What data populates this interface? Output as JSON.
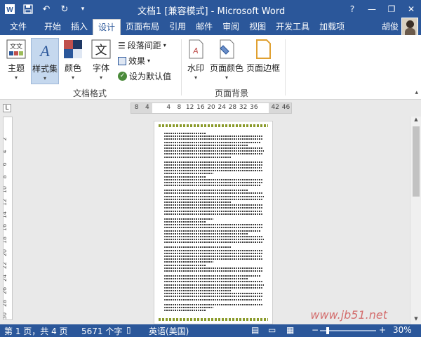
{
  "window": {
    "title": "文档1 [兼容模式] - Microsoft Word",
    "controls": [
      "?",
      "—",
      "❐",
      "✕"
    ]
  },
  "qat": {
    "icons": [
      "word-logo-icon",
      "save-icon",
      "undo-icon",
      "redo-icon",
      "customize-icon"
    ]
  },
  "tabs": {
    "file": "文件",
    "items": [
      "开始",
      "插入",
      "设计",
      "页面布局",
      "引用",
      "邮件",
      "审阅",
      "视图",
      "开发工具",
      "加载项"
    ],
    "active": "设计",
    "user": "胡俊"
  },
  "ribbon": {
    "document_format": {
      "theme_label": "主题",
      "style_set_label": "样式集",
      "colors_label": "颜色",
      "fonts_label": "字体",
      "paragraph_spacing": "段落间距",
      "effects": "效果",
      "set_default": "设为默认值",
      "group_label": "文档格式"
    },
    "page_background": {
      "watermark_label": "水印",
      "page_color_label": "页面颜色",
      "page_borders_label": "页面边框",
      "group_label": "页面背景"
    }
  },
  "ruler": {
    "corner": "L",
    "h_ticks": [
      "8",
      "4",
      "",
      "4",
      "8",
      "12",
      "16",
      "20",
      "24",
      "28",
      "32",
      "36",
      "",
      "42",
      "46"
    ],
    "v_ticks": [
      "2",
      "4",
      "6",
      "8",
      "10",
      "12",
      "14",
      "16",
      "18",
      "20",
      "22",
      "24",
      "26",
      "28",
      "30",
      "32",
      "34",
      "36",
      "38",
      "40",
      "42"
    ]
  },
  "watermark_text": "www.jb51.net",
  "status": {
    "page": "第 1 页，共 4 页",
    "words": "5671 个字",
    "language": "英语(美国)",
    "zoom": "30%",
    "zoom_minus": "−",
    "zoom_plus": "+"
  },
  "colors": {
    "accent": "#2b579a",
    "ribbon_bg": "#ffffff",
    "doc_bg": "#e9e9e9",
    "page_border": "#8a9a2a"
  }
}
